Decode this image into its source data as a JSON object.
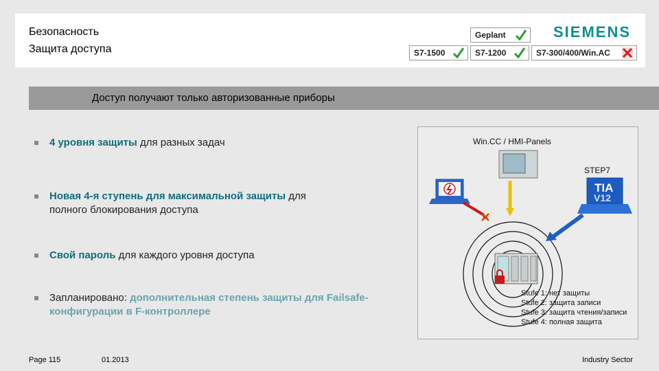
{
  "header": {
    "title_line1": "Безопасность",
    "title_line2": "Защита доступа",
    "logo": "SIEMENS",
    "badges": [
      {
        "label": "Geplant",
        "status": "check"
      },
      {
        "label": "S7-1500",
        "status": "check"
      },
      {
        "label": "S7-1200",
        "status": "check"
      },
      {
        "label": "S7-300/400/Win.AC",
        "status": "cross"
      }
    ],
    "colors": {
      "check": "#2e9b2e",
      "cross": "#d01f1f",
      "logo": "#0f8f8f"
    }
  },
  "banner": {
    "text": "Доступ получают только авторизованные приборы"
  },
  "bullets": [
    {
      "highlight": "4 уровня защиты",
      "rest": " для разных задач"
    },
    {
      "highlight": "Новая 4-я ступень для максимальной защиты",
      "rest": " для",
      "line2": "полного блокирования доступа"
    },
    {
      "highlight": "Свой пароль",
      "rest": " для каждого уровня доступа"
    },
    {
      "lead": "Запланировано:",
      "highlight": "дополнительная степень защиты для Failsafe-",
      "line2": "конфигурации в F-контроллере"
    }
  ],
  "diagram": {
    "wincc_label": "Win.CC / HMI-Panels",
    "step7_label": "STEP7",
    "tia_label": "TIA",
    "tia_version": "V12",
    "stufe": [
      "Stufe 1:  нет защиты",
      "Stufe 2:  защита записи",
      "Stufe 3:  защита чтения/записи",
      "Stufe 4:  полная защита"
    ]
  },
  "footer": {
    "page": "Page 115",
    "date": "01.2013",
    "sector": "Industry Sector"
  }
}
